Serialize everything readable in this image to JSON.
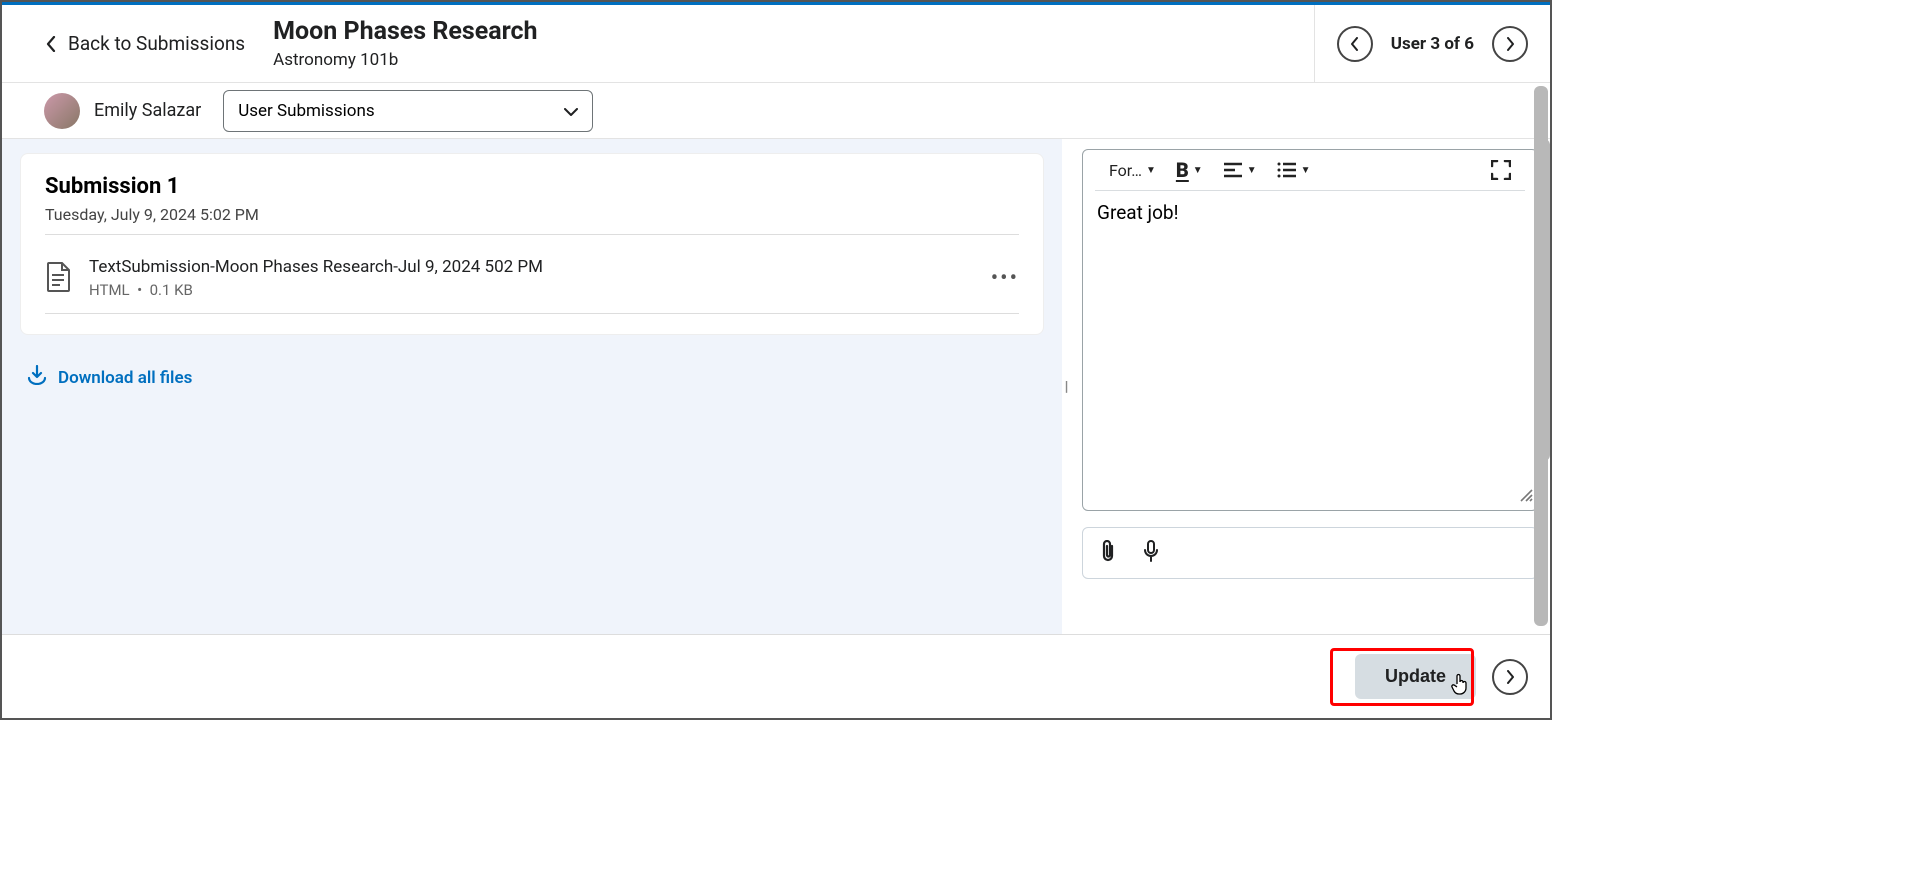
{
  "header": {
    "back_label": "Back to Submissions",
    "assignment_title": "Moon Phases Research",
    "course_name": "Astronomy 101b",
    "user_count_label": "User 3 of 6"
  },
  "subheader": {
    "student_name": "Emily Salazar",
    "submissions_select_label": "User Submissions"
  },
  "submission": {
    "title": "Submission 1",
    "date": "Tuesday, July 9, 2024 5:02 PM",
    "file_name": "TextSubmission-Moon Phases Research-Jul 9, 2024 502 PM",
    "file_type": "HTML",
    "file_size": "0.1 KB",
    "download_label": "Download all files"
  },
  "editor": {
    "format_label": "For…",
    "feedback_text": "Great job!"
  },
  "footer": {
    "update_label": "Update"
  }
}
